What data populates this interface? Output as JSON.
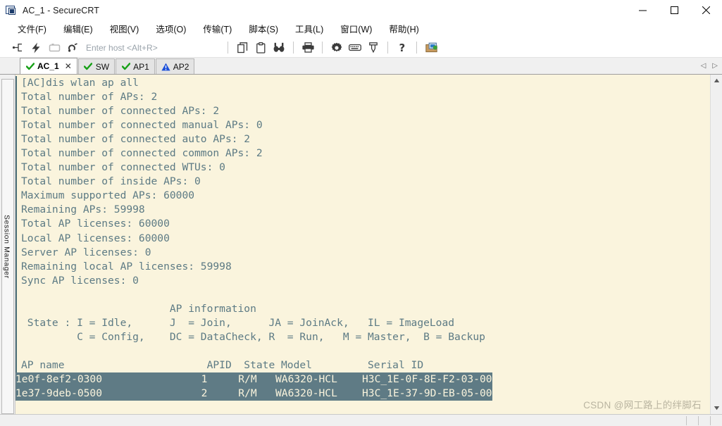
{
  "window": {
    "title": "AC_1 - SecureCRT",
    "icon": "securecrt-app-icon",
    "controls": {
      "minimize": "minimize-icon",
      "maximize": "maximize-icon",
      "close": "close-icon"
    }
  },
  "menubar": {
    "items": [
      {
        "label": "文件(F)",
        "name": "file"
      },
      {
        "label": "编辑(E)",
        "name": "edit"
      },
      {
        "label": "视图(V)",
        "name": "view"
      },
      {
        "label": "选项(O)",
        "name": "options"
      },
      {
        "label": "传输(T)",
        "name": "transfer"
      },
      {
        "label": "脚本(S)",
        "name": "script"
      },
      {
        "label": "工具(L)",
        "name": "tools"
      },
      {
        "label": "窗口(W)",
        "name": "window"
      },
      {
        "label": "帮助(H)",
        "name": "help"
      }
    ]
  },
  "toolbar": {
    "host_placeholder": "Enter host <Alt+R>",
    "icons": [
      "new-session-icon",
      "quick-connect-icon",
      "reconnect-icon",
      "disconnect-icon",
      "copy-icon",
      "paste-icon",
      "find-icon",
      "print-icon",
      "settings-icon",
      "keymap-icon",
      "filter-icon",
      "help-icon",
      "session-manager-icon"
    ]
  },
  "tabs": {
    "items": [
      {
        "label": "AC_1",
        "status": "ok",
        "active": true,
        "closable": true
      },
      {
        "label": "SW",
        "status": "ok",
        "active": false,
        "closable": false
      },
      {
        "label": "AP1",
        "status": "ok",
        "active": false,
        "closable": false
      },
      {
        "label": "AP2",
        "status": "warn",
        "active": false,
        "closable": false
      }
    ],
    "scroll_left": "◁",
    "scroll_right": "▷"
  },
  "sidebar": {
    "session_manager_label": "Session Manager"
  },
  "terminal": {
    "colors": {
      "background": "#faf4dd",
      "foreground": "#5c7a84",
      "selection_background": "#5f7b85",
      "selection_foreground": "#faf4dd"
    },
    "lines": [
      "[AC]dis wlan ap all",
      "Total number of APs: 2",
      "Total number of connected APs: 2",
      "Total number of connected manual APs: 0",
      "Total number of connected auto APs: 2",
      "Total number of connected common APs: 2",
      "Total number of connected WTUs: 0",
      "Total number of inside APs: 0",
      "Maximum supported APs: 60000",
      "Remaining APs: 59998",
      "Total AP licenses: 60000",
      "Local AP licenses: 60000",
      "Server AP licenses: 0",
      "Remaining local AP licenses: 59998",
      "Sync AP licenses: 0",
      "",
      "                        AP information",
      " State : I = Idle,      J  = Join,      JA = JoinAck,   IL = ImageLoad",
      "         C = Config,    DC = DataCheck, R  = Run,   M = Master,  B = Backup",
      ""
    ],
    "table_header": "AP name                       APID  State Model         Serial ID",
    "selected_rows": [
      "1e0f-8ef2-0300                1     R/M   WA6320-HCL    H3C_1E-0F-8E-F2-03-00",
      "1e37-9deb-0500                2     R/M   WA6320-HCL    H3C_1E-37-9D-EB-05-00"
    ],
    "watermark": "CSDN @网工路上的绊脚石"
  },
  "scrollbar": {
    "up_arrow": "scroll-up-icon",
    "down_arrow": "scroll-down-icon"
  },
  "statusbar": {
    "cells": [
      "",
      "",
      "",
      ""
    ]
  }
}
